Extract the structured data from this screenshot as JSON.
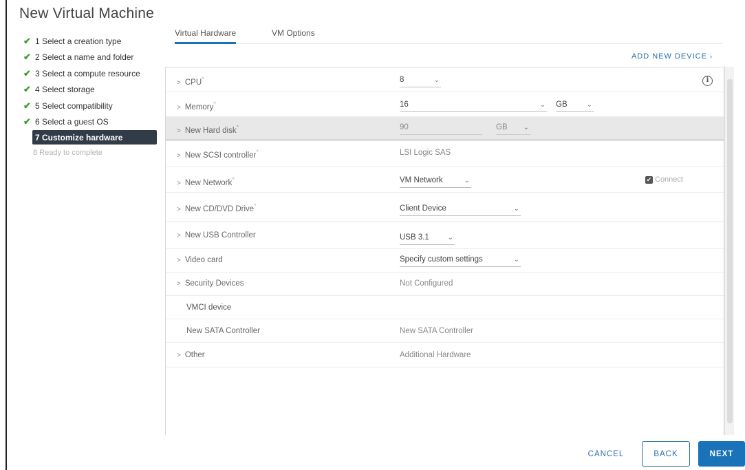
{
  "window": {
    "title": "New Virtual Machine"
  },
  "steps": [
    {
      "label": "1 Select a creation type",
      "state": "done"
    },
    {
      "label": "2 Select a name and folder",
      "state": "done"
    },
    {
      "label": "3 Select a compute resource",
      "state": "done"
    },
    {
      "label": "4 Select storage",
      "state": "done"
    },
    {
      "label": "5 Select compatibility",
      "state": "done"
    },
    {
      "label": "6 Select a guest OS",
      "state": "done"
    },
    {
      "label": "7 Customize hardware",
      "state": "active"
    },
    {
      "label": "8 Ready to complete",
      "state": "inactive"
    }
  ],
  "tabs": [
    {
      "label": "Virtual Hardware",
      "active": true
    },
    {
      "label": "VM Options",
      "active": false
    }
  ],
  "add_device_label": "ADD NEW DEVICE",
  "hardware": {
    "cpu": {
      "label": "CPU",
      "value": "8"
    },
    "memory": {
      "label": "Memory",
      "value": "16",
      "unit": "GB"
    },
    "hard_disk": {
      "label": "New Hard disk",
      "value": "90",
      "unit": "GB"
    },
    "scsi": {
      "label": "New SCSI controller",
      "value": "LSI Logic SAS"
    },
    "network": {
      "label": "New Network",
      "value": "VM Network",
      "connect_label": "Connect"
    },
    "cd_dvd": {
      "label": "New CD/DVD Drive",
      "value": "Client Device"
    },
    "usb": {
      "label": "New USB Controller",
      "value": "USB 3.1"
    },
    "video": {
      "label": "Video card",
      "value": "Specify custom settings"
    },
    "security": {
      "label": "Security Devices",
      "value": "Not Configured"
    },
    "vmci": {
      "label": "VMCI device"
    },
    "sata": {
      "label": "New SATA Controller",
      "value": "New SATA Controller"
    },
    "other": {
      "label": "Other",
      "value": "Additional Hardware"
    }
  },
  "buttons": {
    "cancel": "CANCEL",
    "back": "BACK",
    "next": "NEXT"
  },
  "colors": {
    "accent": "#1a72b9",
    "check": "#3d9a2c",
    "active_step_bg": "#313c48"
  }
}
